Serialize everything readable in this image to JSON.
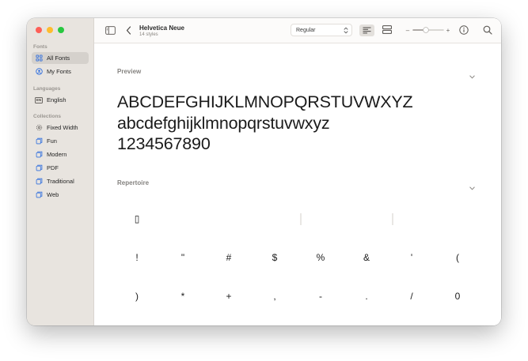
{
  "window": {
    "traffic_lights": [
      "close",
      "minimize",
      "zoom"
    ]
  },
  "sidebar": {
    "sections": [
      {
        "label": "Fonts",
        "items": [
          {
            "label": "All Fonts",
            "icon": "grid-icon",
            "selected": true
          },
          {
            "label": "My Fonts",
            "icon": "person-circle-icon",
            "selected": false
          }
        ]
      },
      {
        "label": "Languages",
        "items": [
          {
            "label": "English",
            "icon": "en-badge-icon",
            "badge": "EN",
            "selected": false
          }
        ]
      },
      {
        "label": "Collections",
        "items": [
          {
            "label": "Fixed Width",
            "icon": "gear-icon"
          },
          {
            "label": "Fun",
            "icon": "collection-icon"
          },
          {
            "label": "Modern",
            "icon": "collection-icon"
          },
          {
            "label": "PDF",
            "icon": "collection-icon"
          },
          {
            "label": "Traditional",
            "icon": "collection-icon"
          },
          {
            "label": "Web",
            "icon": "collection-icon"
          }
        ]
      }
    ]
  },
  "toolbar": {
    "font_name": "Helvetica Neue",
    "styles_count": "14 styles",
    "style_select": "Regular",
    "zoom_minus": "–",
    "zoom_plus": "+"
  },
  "preview": {
    "title": "Preview",
    "lines": [
      "ABCDEFGHIJKLMNOPQRSTUVWXYZ",
      "abcdefghijklmnopqrstuvwxyz",
      "1234567890"
    ]
  },
  "repertoire": {
    "title": "Repertoire",
    "rows": [
      [
        "▯",
        "",
        "",
        "",
        "",
        "",
        "",
        ""
      ],
      [
        "!",
        "\"",
        "#",
        "$",
        "%",
        "&",
        "'",
        "("
      ],
      [
        ")",
        "*",
        "+",
        ",",
        "-",
        ".",
        "/",
        "0"
      ]
    ]
  },
  "colors": {
    "sidebar_bg": "#e8e4df",
    "selected_bg": "#d5d1cc",
    "accent": "#2f6ede",
    "close": "#fe5f57",
    "minimize": "#febc2e",
    "zoom": "#28c840"
  }
}
